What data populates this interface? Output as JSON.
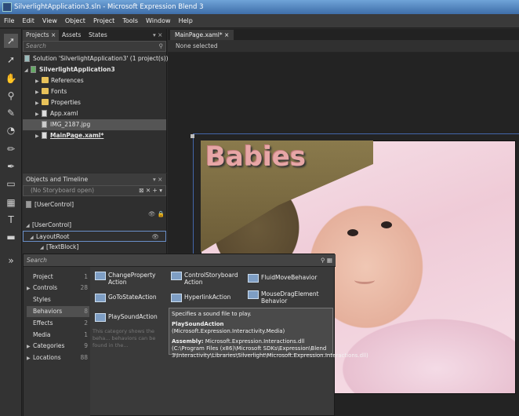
{
  "window": {
    "title": "SilverlightApplication3.sln - Microsoft Expression Blend 3"
  },
  "menu": [
    "File",
    "Edit",
    "View",
    "Object",
    "Project",
    "Tools",
    "Window",
    "Help"
  ],
  "left_tabs": {
    "projects": "Projects",
    "assets": "Assets",
    "states": "States"
  },
  "project_search": "Search",
  "project_tree": [
    "Solution 'SilverlightApplication3' (1 project(s))",
    "SilverlightApplication3",
    "References",
    "Fonts",
    "Properties",
    "App.xaml",
    "IMG_2187.jpg",
    "MainPage.xaml*"
  ],
  "objects": {
    "title": "Objects and Timeline",
    "storyboard": "(No Storyboard open)",
    "usercontrol_top": "[UserControl]",
    "usercontrol": "[UserControl]",
    "layoutroot": "LayoutRoot",
    "textblock": "[TextBlock]"
  },
  "editor": {
    "doc_tab": "MainPage.xaml*",
    "selection": "None selected",
    "banner": "Babies"
  },
  "assets_popup": {
    "search": "Search",
    "categories": [
      {
        "label": "Project",
        "count": "1"
      },
      {
        "label": "Controls",
        "count": "28"
      },
      {
        "label": "Styles",
        "count": ""
      },
      {
        "label": "Behaviors",
        "count": "8"
      },
      {
        "label": "Effects",
        "count": "2"
      },
      {
        "label": "Media",
        "count": "1"
      },
      {
        "label": "Categories",
        "count": "9"
      },
      {
        "label": "Locations",
        "count": "88"
      }
    ],
    "behaviors": [
      "ChangeProperty Action",
      "ControlStoryboard Action",
      "FluidMoveBehavior",
      "GoToStateAction",
      "HyperlinkAction",
      "MouseDragElement Behavior",
      "PlaySoundAction"
    ],
    "hint": "This category shows the beha... behaviors can be found in the...",
    "tooltip": {
      "line1": "Specifies a sound file to play.",
      "name": "PlaySoundAction",
      "ns": " (Microsoft.Expression.Interactivity.Media)",
      "asm_label": "Assembly:",
      "asm": " Microsoft.Expression.Interactions.dll (C:\\Program Files (x86)\\Microsoft SDKs\\Expression\\Blend 3\\Interactivity\\Libraries\\Silverlight\\Microsoft.Expression.Interactions.dll)"
    }
  }
}
